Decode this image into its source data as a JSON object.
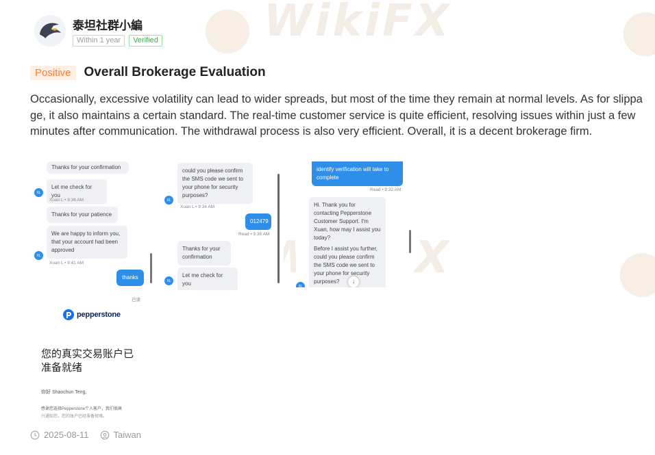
{
  "user": {
    "name": "泰坦社群小編",
    "tenure": "Within 1 year",
    "verified": "Verified"
  },
  "post": {
    "sentiment": "Positive",
    "title": "Overall Brokerage Evaluation",
    "body": "Occasionally, excessive volatility can lead to wider spreads, but most of the time they remain at normal levels. As for slippage, it also maintains a certain standard. The real-time customer service is quite efficient, resolving issues within just a few minutes after communication. The withdrawal process is also very efficient. Overall, it is a decent brokerage firm.",
    "date": "2025-08-11",
    "location": "Taiwan"
  },
  "watermark": {
    "text": "WikiFX"
  },
  "chat1": {
    "b1": "Thanks for your confirmation",
    "b2": "Let me check for you",
    "m2": "Xuan L • 9:36 AM",
    "b3": "Thanks for your patience",
    "b4": "We are happy to inform you, that your account had been approved",
    "m4": "Xuan L • 9:41 AM",
    "b5": "thanks",
    "m5": "已读"
  },
  "chat2": {
    "b1": "could you please confirm the SMS code we sent to your phone for security purposes?",
    "m1": "Xuan L • 9:34 AM",
    "b2": "012479",
    "m2": "Read • 9:36 AM",
    "b3": "Thanks for your confirmation",
    "b4": "Let me check for you"
  },
  "chat3": {
    "b1": "identify verification will take to complete",
    "m1": "Read • 9:32 AM",
    "b2": "Hi. Thank you for contacting Pepperstone Customer Support. I'm Xuan, how may I assist you today?",
    "b3": "Before I assist you further, could you please confirm the SMS code we sent to your phone for security purposes?"
  },
  "email": {
    "brand": "pepperstone",
    "headline_1": "您的真实交易账户已",
    "headline_2": "准备就绪",
    "greeting": "你好 Shaochun Teng,",
    "line1": "感谢您选择Pepperstone个人客户，我们很高",
    "line2": "兴通知您，您的账户已经准备就绪。"
  },
  "colors": {
    "sentiment_bg": "#fff0e6",
    "sentiment_fg": "#ff7a33",
    "verified": "#37b24d",
    "chat_blue": "#2f8fe8"
  }
}
